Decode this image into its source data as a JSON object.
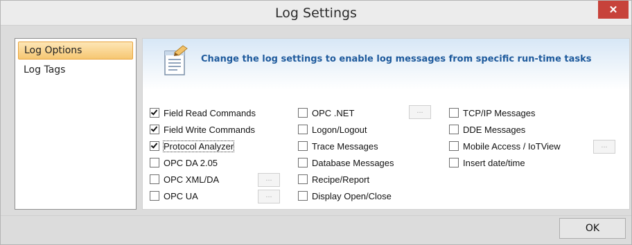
{
  "window": {
    "title": "Log Settings",
    "close_glyph": "✕"
  },
  "sidebar": {
    "items": [
      {
        "label": "Log Options",
        "selected": true
      },
      {
        "label": "Log Tags",
        "selected": false
      }
    ]
  },
  "header": {
    "text": "Change the log settings to enable log messages from specific run-time tasks",
    "icon": "document-edit-icon"
  },
  "options": {
    "col1": [
      {
        "label": "Field Read Commands",
        "checked": true
      },
      {
        "label": "Field Write Commands",
        "checked": true
      },
      {
        "label": "Protocol Analyzer",
        "checked": true
      },
      {
        "label": "OPC DA 2.05",
        "checked": false
      },
      {
        "label": "OPC XML/DA",
        "checked": false
      },
      {
        "label": "OPC UA",
        "checked": false
      }
    ],
    "col2": [
      {
        "label": "OPC .NET",
        "checked": false
      },
      {
        "label": "Logon/Logout",
        "checked": false
      },
      {
        "label": "Trace Messages",
        "checked": false
      },
      {
        "label": "Database Messages",
        "checked": false
      },
      {
        "label": "Recipe/Report",
        "checked": false
      },
      {
        "label": "Display Open/Close",
        "checked": false
      }
    ],
    "col3": [
      {
        "label": "TCP/IP Messages",
        "checked": false
      },
      {
        "label": "DDE Messages",
        "checked": false
      },
      {
        "label": "Mobile Access / IoTView",
        "checked": false
      },
      {
        "label": "Insert date/time",
        "checked": false
      }
    ]
  },
  "buttons": {
    "ellipsis": "...",
    "ok": "OK"
  },
  "colors": {
    "accent": "#1e5a9c",
    "close": "#c7423a",
    "selection": "#f6c772"
  }
}
